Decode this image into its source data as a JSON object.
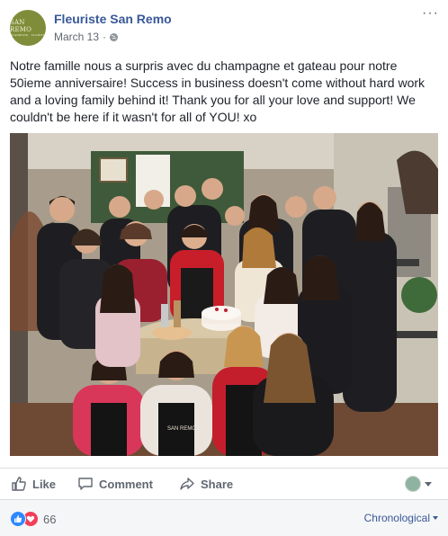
{
  "post": {
    "author": {
      "name": "Fleuriste San Remo",
      "avatar_logo_text": "SAN REMO",
      "avatar_logo_subtext": "FLEURISTE · FLORIST",
      "avatar_color": "#7f8d3a"
    },
    "timestamp": "March 13",
    "separator": "·",
    "audience_icon": "globe-icon",
    "more_icon": "ellipsis-icon",
    "more_label": "···",
    "text": "Notre famille nous a surpris avec du champagne et gateau pour notre 50ieme anniversaire! Success in business doesn't come without hard work and a loving family behind it! Thank you for all your love and support! We couldn't be here if it wasn't for all of YOU! xo",
    "photo": {
      "description_icon": "group-photo",
      "apron_text": "SAN REMO"
    }
  },
  "actions": {
    "like_label": "Like",
    "comment_label": "Comment",
    "share_label": "Share"
  },
  "reactions": {
    "count": "66",
    "types": [
      "like",
      "love"
    ],
    "like_color": "#2e89ff",
    "love_color": "#f33e58"
  },
  "comments": {
    "sort_label": "Chronological"
  },
  "colors": {
    "link": "#385898",
    "secondary_text": "#616770",
    "border": "#dadde1"
  }
}
